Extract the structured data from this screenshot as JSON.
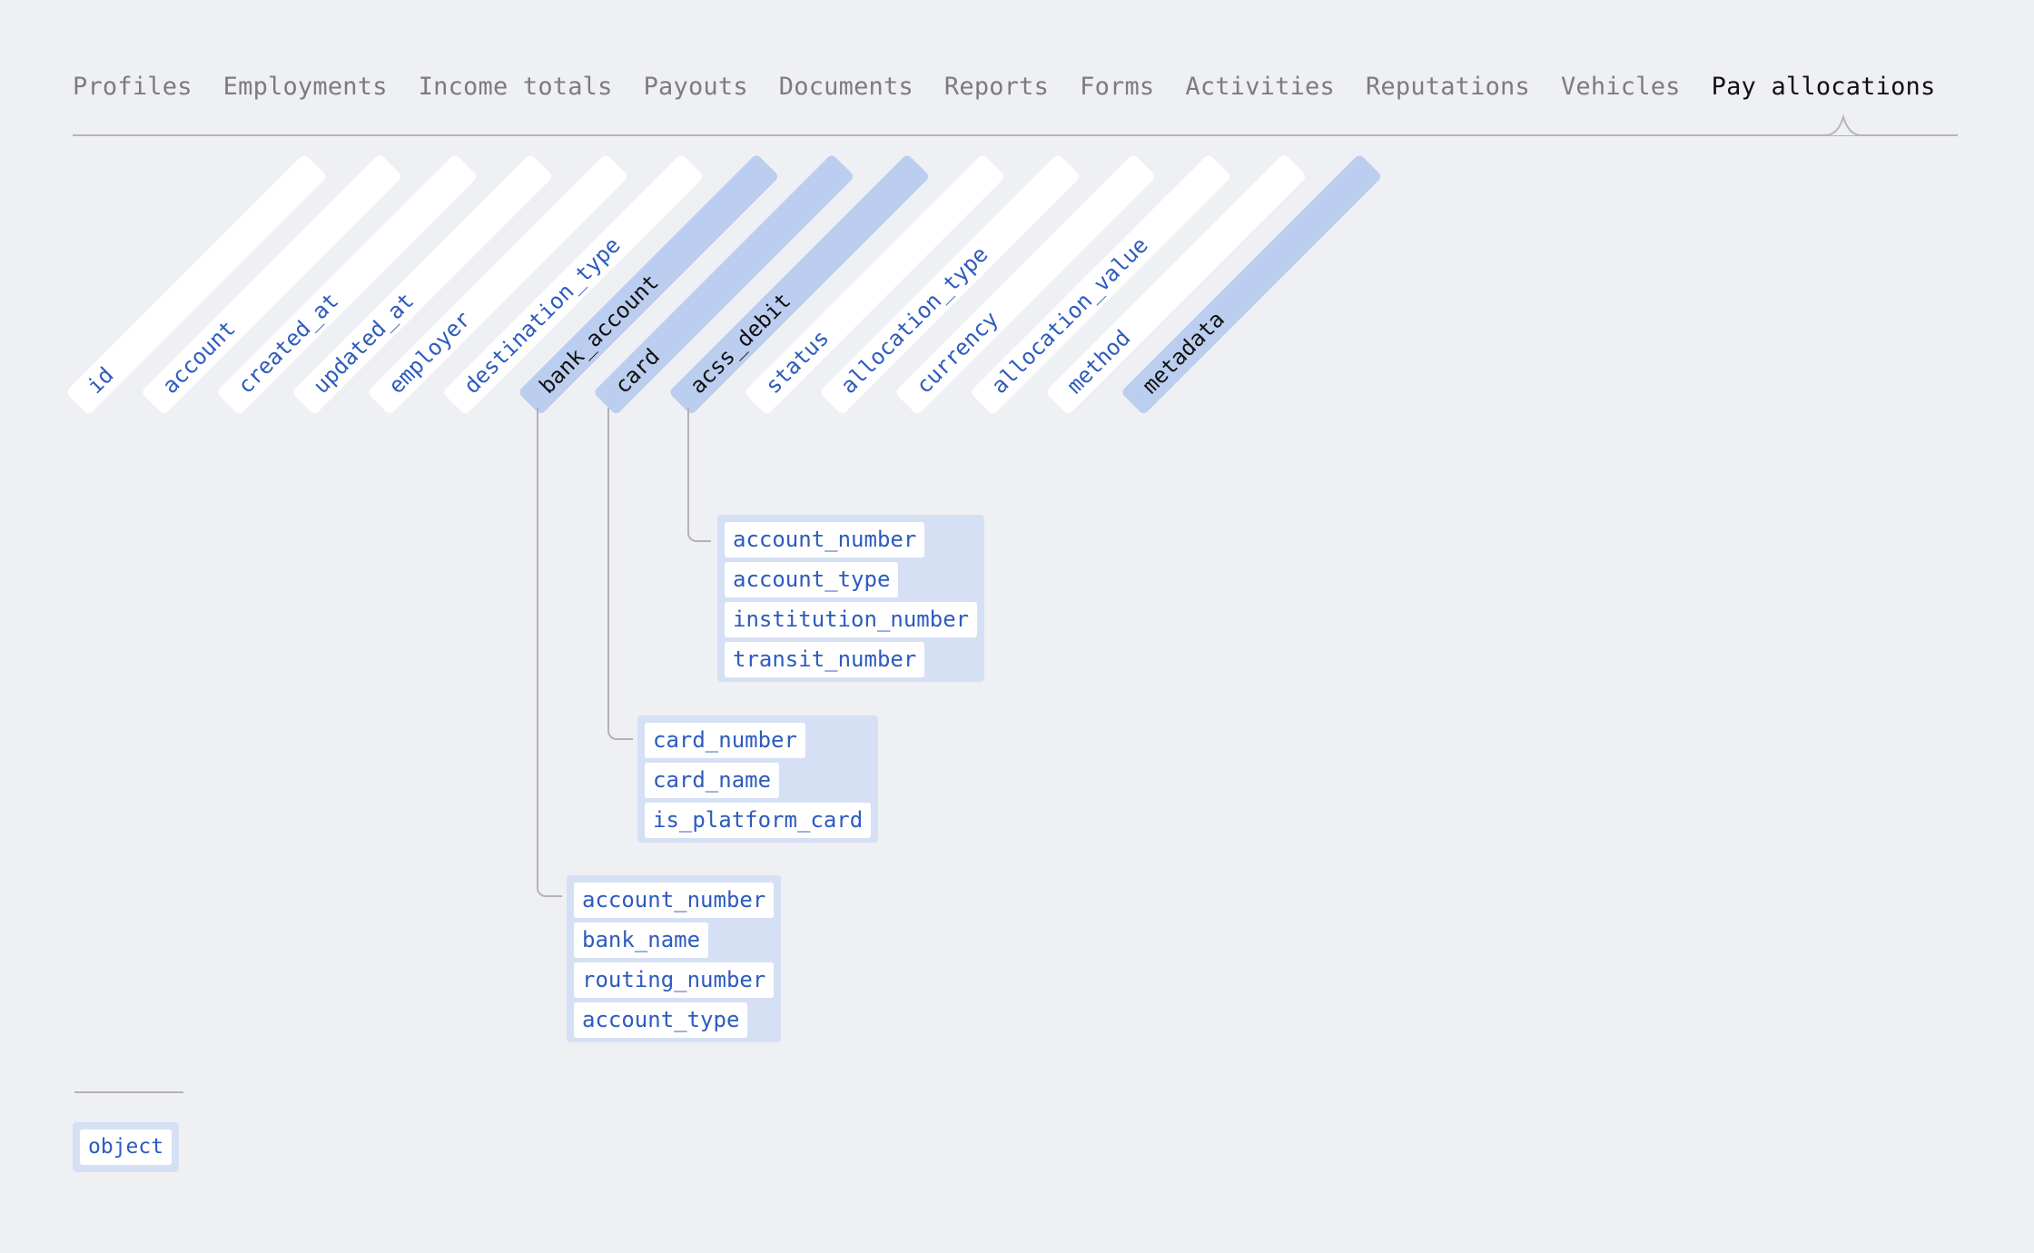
{
  "tabs": [
    {
      "label": "Profiles",
      "active": false
    },
    {
      "label": "Employments",
      "active": false
    },
    {
      "label": "Income totals",
      "active": false
    },
    {
      "label": "Payouts",
      "active": false
    },
    {
      "label": "Documents",
      "active": false
    },
    {
      "label": "Reports",
      "active": false
    },
    {
      "label": "Forms",
      "active": false
    },
    {
      "label": "Activities",
      "active": false
    },
    {
      "label": "Reputations",
      "active": false
    },
    {
      "label": "Vehicles",
      "active": false
    },
    {
      "label": "Pay allocations",
      "active": true
    }
  ],
  "fields": [
    {
      "name": "id",
      "type": "scalar"
    },
    {
      "name": "account",
      "type": "scalar"
    },
    {
      "name": "created_at",
      "type": "scalar"
    },
    {
      "name": "updated_at",
      "type": "scalar"
    },
    {
      "name": "employer",
      "type": "scalar"
    },
    {
      "name": "destination_type",
      "type": "scalar"
    },
    {
      "name": "bank_account",
      "type": "object"
    },
    {
      "name": "card",
      "type": "object"
    },
    {
      "name": "acss_debit",
      "type": "object"
    },
    {
      "name": "status",
      "type": "scalar"
    },
    {
      "name": "allocation_type",
      "type": "scalar"
    },
    {
      "name": "currency",
      "type": "scalar"
    },
    {
      "name": "allocation_value",
      "type": "scalar"
    },
    {
      "name": "method",
      "type": "scalar"
    },
    {
      "name": "metadata",
      "type": "object"
    }
  ],
  "subgroups": {
    "acss_debit": [
      "account_number",
      "account_type",
      "institution_number",
      "transit_number"
    ],
    "card": [
      "card_number",
      "card_name",
      "is_platform_card"
    ],
    "bank_account": [
      "account_number",
      "bank_name",
      "routing_number",
      "account_type"
    ]
  },
  "legend": {
    "object_label": "object"
  },
  "colors": {
    "background": "#eff0f4",
    "object_fill": "#bccef0",
    "group_fill": "#d6e0f5",
    "field_text": "#2d5bbd",
    "active_tab": "#111111",
    "inactive_tab": "#7c7c7c"
  }
}
